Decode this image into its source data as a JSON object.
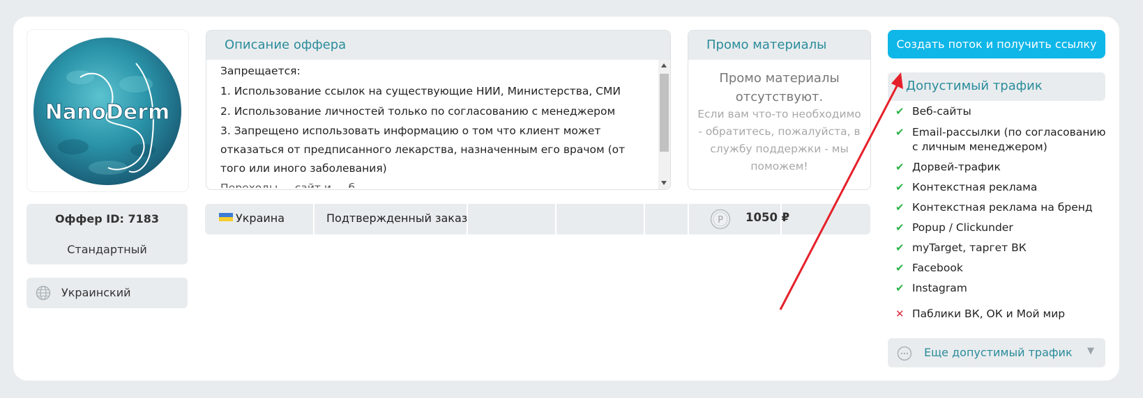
{
  "logo": {
    "text": "NanoDerm"
  },
  "offer": {
    "id_label": "Оффер ID: 7183",
    "type": "Стандартный",
    "language": "Украинский",
    "language_icon": "globe-icon"
  },
  "description": {
    "title": "Описание оффера",
    "lines": [
      "Запрещается:",
      "1. Использование ссылок на существующие НИИ, Министерства, СМИ",
      "2. Использование личностей только по согласованию с менеджером",
      "3. Запрещено использовать информацию о том что клиент может отказаться от предписанного лекарства, назначенным его врачом (от того или иного заболевания)",
      "Переходы ... сайт и ... б"
    ]
  },
  "promo": {
    "title": "Промо материалы",
    "empty_text": "Промо материалы отсутствуют.",
    "help_text": "Если вам что-то необходимо - обратитесь, пожалуйста, в службу поддержки - мы поможем!"
  },
  "offer_row": {
    "country": "Украина",
    "action": "Подтвержденный заказ",
    "price": "1050 ₽",
    "coin_icon": "ruble-coin-icon"
  },
  "actions": {
    "create_stream": "Создать поток и получить ссылку"
  },
  "traffic": {
    "title": "Допустимый трафик",
    "items": [
      {
        "label": "Веб-сайты",
        "allowed": true
      },
      {
        "label": "Email-рассылки (по согласованию с личным менеджером)",
        "allowed": true
      },
      {
        "label": "Дорвей-трафик",
        "allowed": true
      },
      {
        "label": "Контекстная реклама",
        "allowed": true
      },
      {
        "label": "Контекстная реклама на бренд",
        "allowed": true
      },
      {
        "label": "Popup / Clickunder",
        "allowed": true
      },
      {
        "label": "myTarget, таргет ВК",
        "allowed": true
      },
      {
        "label": "Facebook",
        "allowed": true
      },
      {
        "label": "Instagram",
        "allowed": true
      },
      {
        "label": "Паблики ВК, ОК и Мой мир",
        "allowed": false
      }
    ],
    "more_label": "Еще допустимый трафик"
  },
  "colors": {
    "accent": "#0fb6e8",
    "teal_text": "#2a8c9b",
    "panel_bg": "#e9ecee",
    "ok": "#2db34a",
    "no": "#e02c3c",
    "arrow": "#e5202a"
  }
}
